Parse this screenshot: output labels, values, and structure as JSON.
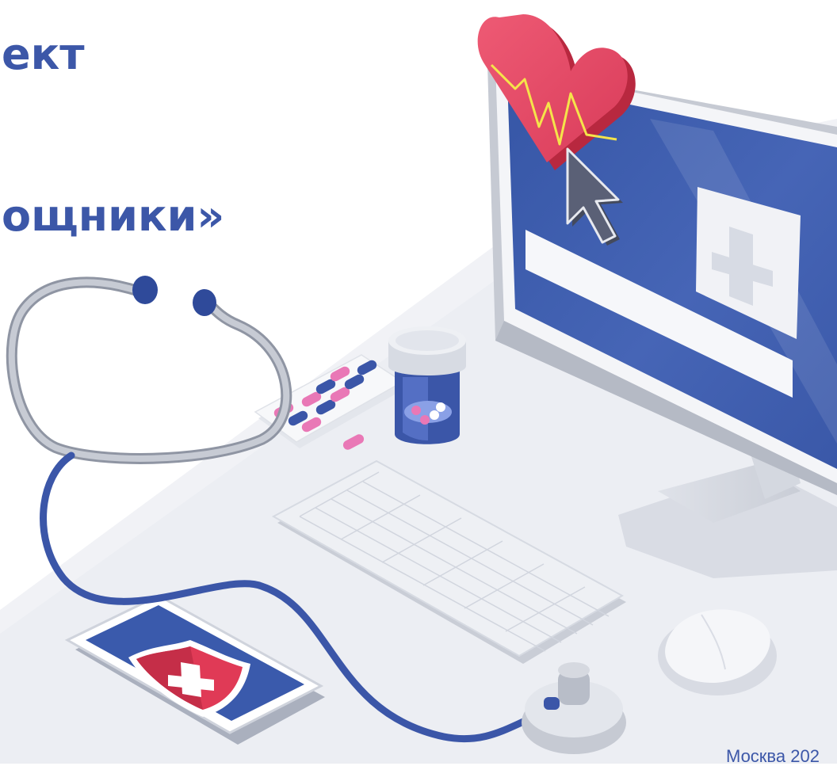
{
  "title": {
    "line1": "ект",
    "line2": "ощники»"
  },
  "footer": {
    "city_year": "Москва 202"
  },
  "colors": {
    "brand_blue": "#3c57a8",
    "accent_red": "#e03a56",
    "heart_pink": "#e8566f",
    "floor_gray": "#eef0f5",
    "screen_blue": "#3d5aab",
    "pill_pink": "#e978b6"
  },
  "illustration": {
    "icons": [
      "heart-pulse-icon",
      "cursor-arrow-icon",
      "medical-cross-icon",
      "shield-cross-icon",
      "stethoscope-icon",
      "pill-bottle-icon",
      "blister-pack-icon",
      "keyboard-icon",
      "mouse-icon",
      "smartphone-icon",
      "monitor-icon"
    ]
  }
}
